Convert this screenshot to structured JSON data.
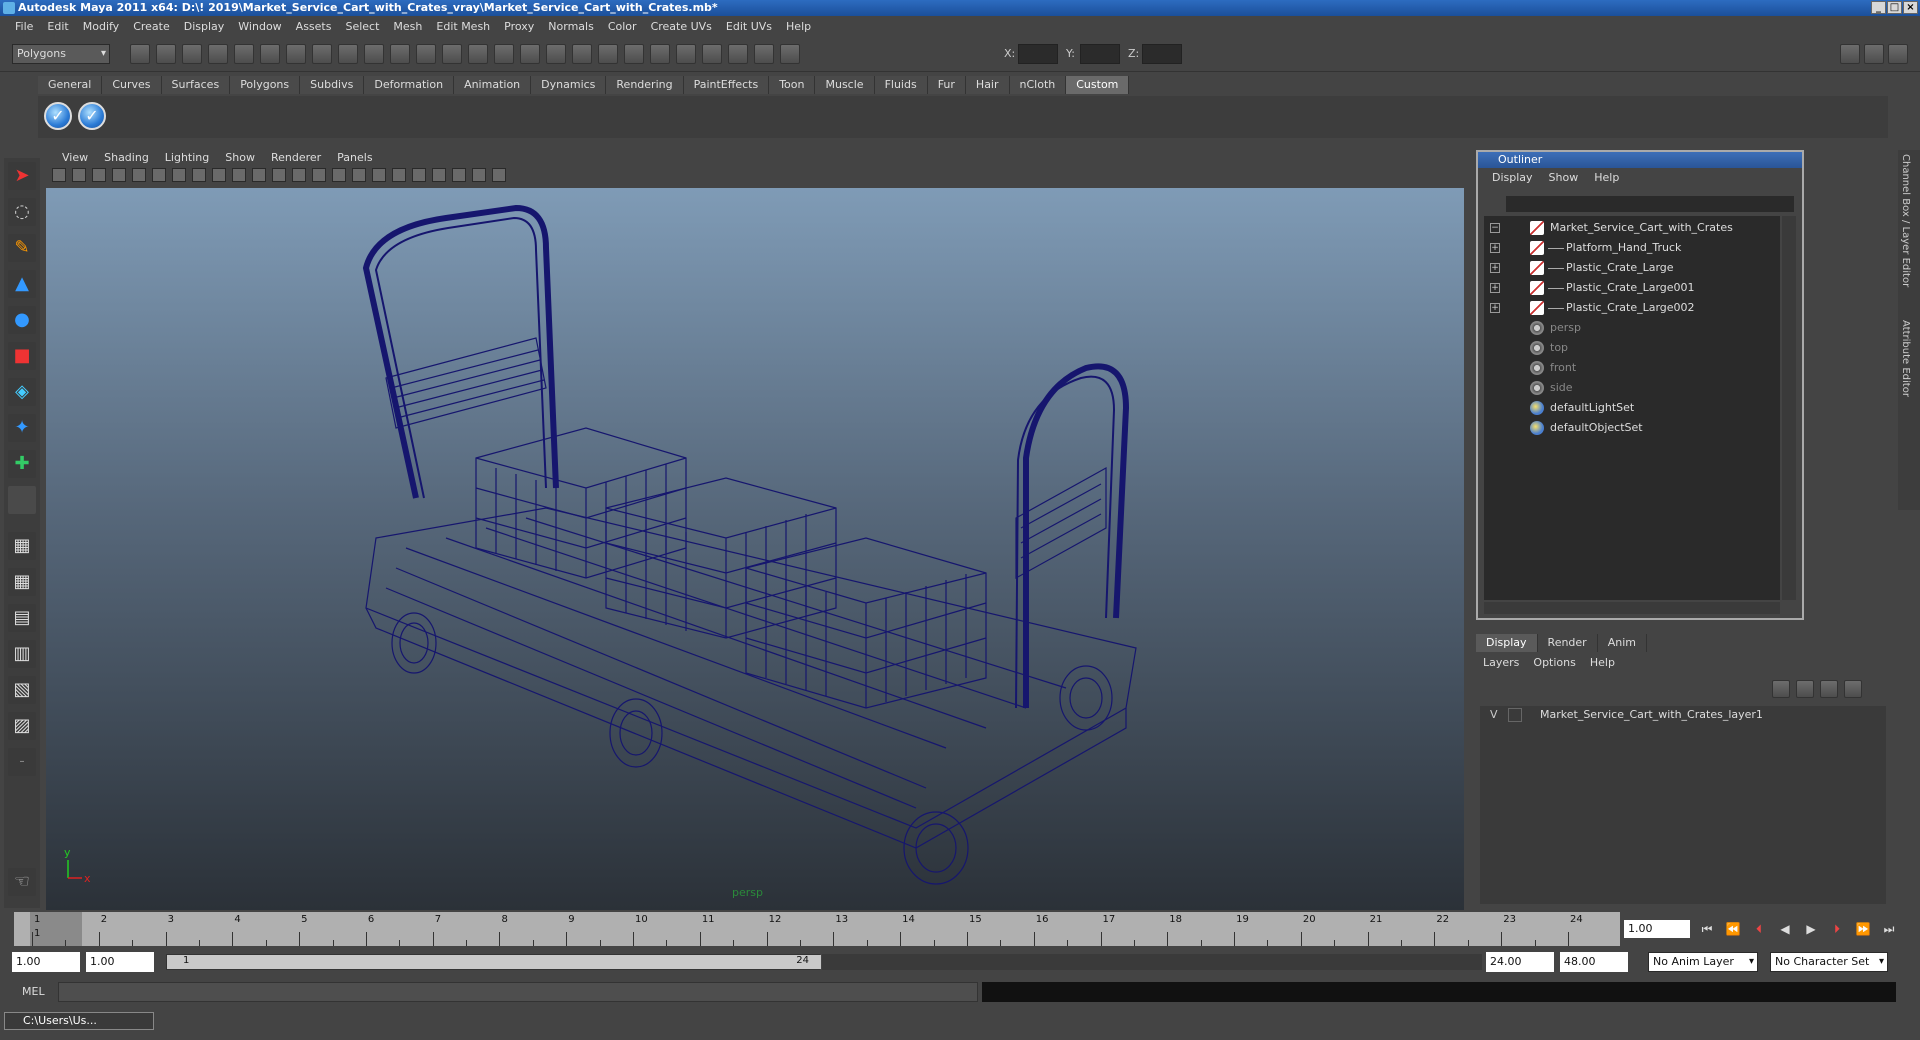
{
  "window": {
    "title": "Autodesk Maya 2011 x64: D:\\! 2019\\Market_Service_Cart_with_Crates_vray\\Market_Service_Cart_with_Crates.mb*",
    "buttons": [
      "_",
      "□",
      "×"
    ]
  },
  "menubar": [
    "File",
    "Edit",
    "Modify",
    "Create",
    "Display",
    "Window",
    "Assets",
    "Select",
    "Mesh",
    "Edit Mesh",
    "Proxy",
    "Normals",
    "Color",
    "Create UVs",
    "Edit UVs",
    "Help"
  ],
  "statusline": {
    "mode": "Polygons",
    "x_label": "X:",
    "y_label": "Y:",
    "z_label": "Z:"
  },
  "shelf": {
    "tabs": [
      "General",
      "Curves",
      "Surfaces",
      "Polygons",
      "Subdivs",
      "Deformation",
      "Animation",
      "Dynamics",
      "Rendering",
      "PaintEffects",
      "Toon",
      "Muscle",
      "Fluids",
      "Fur",
      "Hair",
      "nCloth",
      "Custom"
    ],
    "active": "Custom",
    "icons": [
      "check-icon",
      "check-icon"
    ]
  },
  "viewport": {
    "menu": [
      "View",
      "Shading",
      "Lighting",
      "Show",
      "Renderer",
      "Panels"
    ],
    "camera": "persp",
    "wire_color": "#16166e",
    "axis_y": "y",
    "axis_x": "x"
  },
  "outliner": {
    "title": "Outliner",
    "menu": [
      "Display",
      "Show",
      "Help"
    ],
    "items": [
      {
        "label": "Market_Service_Cart_with_Crates",
        "type": "mesh",
        "expand": "−",
        "level": 0
      },
      {
        "label": "Platform_Hand_Truck",
        "type": "mesh",
        "expand": "+",
        "level": 1
      },
      {
        "label": "Plastic_Crate_Large",
        "type": "mesh",
        "expand": "+",
        "level": 1
      },
      {
        "label": "Plastic_Crate_Large001",
        "type": "mesh",
        "expand": "+",
        "level": 1
      },
      {
        "label": "Plastic_Crate_Large002",
        "type": "mesh",
        "expand": "+",
        "level": 1
      },
      {
        "label": "persp",
        "type": "cam",
        "dim": true
      },
      {
        "label": "top",
        "type": "cam",
        "dim": true
      },
      {
        "label": "front",
        "type": "cam",
        "dim": true
      },
      {
        "label": "side",
        "type": "cam",
        "dim": true
      },
      {
        "label": "defaultLightSet",
        "type": "set"
      },
      {
        "label": "defaultObjectSet",
        "type": "set"
      }
    ]
  },
  "layers": {
    "tabs": [
      "Display",
      "Render",
      "Anim"
    ],
    "active": "Display",
    "menu": [
      "Layers",
      "Options",
      "Help"
    ],
    "layer_visible": "V",
    "layer_name": "Market_Service_Cart_with_Crates_layer1"
  },
  "time": {
    "ticks": [
      "1",
      "2",
      "3",
      "4",
      "5",
      "6",
      "7",
      "8",
      "9",
      "10",
      "11",
      "12",
      "13",
      "14",
      "15",
      "16",
      "17",
      "18",
      "19",
      "20",
      "21",
      "22",
      "23",
      "24"
    ],
    "current_frame": "1.00",
    "current_marker": "1"
  },
  "range": {
    "start": "1.00",
    "start2": "1.00",
    "slider_start": "1",
    "slider_end": "24",
    "end": "24.00",
    "end2": "48.00",
    "anim_layer": "No Anim Layer",
    "char_set": "No Character Set"
  },
  "cmdline": {
    "label": "MEL"
  },
  "taskbar": {
    "item": "C:\\Users\\Us..."
  },
  "sidetabs": [
    "Channel Box / Layer Editor",
    "Attribute Editor"
  ]
}
